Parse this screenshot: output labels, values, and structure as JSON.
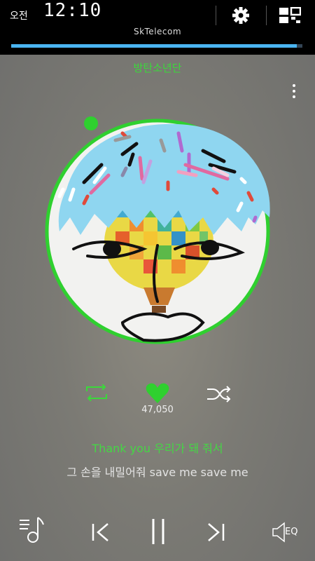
{
  "status_bar": {
    "ampm": "오전",
    "time": "12:10",
    "carrier": "SkTelecom",
    "icons": [
      "gear-icon",
      "grid-icon"
    ]
  },
  "player": {
    "artist": "방탄소년단",
    "progress": 0.98,
    "like_count": "47,050",
    "lyrics": {
      "current": "Thank you 우리가 돼 줘서",
      "next": "그 손을 내밀어줘 save me save me"
    },
    "eq_label": "EQ"
  },
  "colors": {
    "accent_green": "#3bd83b",
    "progress_blue": "#4ab4f0"
  }
}
